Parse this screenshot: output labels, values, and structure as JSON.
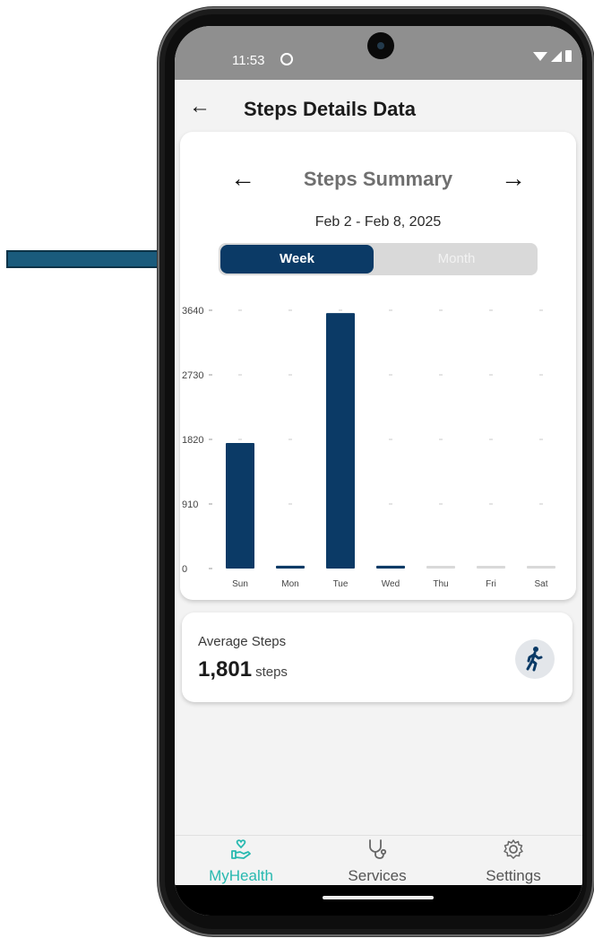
{
  "status_bar": {
    "time": "11:53"
  },
  "header": {
    "title": "Steps Details Data"
  },
  "summary": {
    "title": "Steps Summary",
    "date_range": "Feb 2 - Feb 8, 2025",
    "toggle": {
      "week_label": "Week",
      "month_label": "Month",
      "selected": "Week"
    }
  },
  "chart_data": {
    "type": "bar",
    "categories": [
      "Sun",
      "Mon",
      "Tue",
      "Wed",
      "Thu",
      "Fri",
      "Sat"
    ],
    "values": [
      1770,
      40,
      3600,
      40,
      0,
      0,
      0
    ],
    "y_ticks": [
      "0",
      "910",
      "1820",
      "2730",
      "3640"
    ],
    "ylim": [
      0,
      3640
    ],
    "bar_color": "#0b3a66",
    "empty_bar_color": "#d9d9d9",
    "title": "",
    "xlabel": "",
    "ylabel": ""
  },
  "average": {
    "label": "Average Steps",
    "value": "1,801",
    "unit": "steps"
  },
  "bottom_nav": {
    "items": [
      {
        "label": "MyHealth",
        "icon": "heart-hand-icon",
        "active": true
      },
      {
        "label": "Services",
        "icon": "stethoscope-icon",
        "active": false
      },
      {
        "label": "Settings",
        "icon": "gear-icon",
        "active": false
      }
    ]
  },
  "colors": {
    "accent": "#0b3a66",
    "nav_active": "#28b9b0",
    "status_bar": "#8f8f8f"
  }
}
